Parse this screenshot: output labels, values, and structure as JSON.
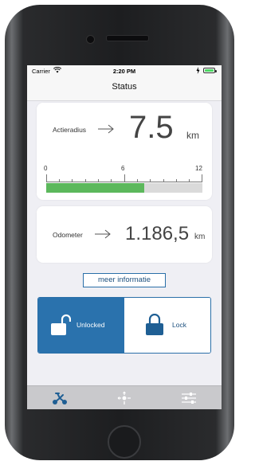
{
  "status_bar": {
    "carrier": "Carrier",
    "time": "2:20 PM"
  },
  "nav": {
    "title": "Status"
  },
  "range_card": {
    "label": "Actieradius",
    "value": "7.5",
    "unit": "km",
    "scale_ticks": [
      "0",
      "6",
      "12"
    ],
    "scale_min": 0,
    "scale_max": 12,
    "current": 7.5,
    "fill_color": "#5cb85c"
  },
  "odometer_card": {
    "label": "Odometer",
    "value": "1.186,5",
    "unit": "km"
  },
  "info_button": {
    "label": "meer informatie"
  },
  "lock_control": {
    "unlocked_label": "Unlocked",
    "lock_label": "Lock",
    "selected": "unlocked",
    "accent": "#2a72ad"
  },
  "tabs": [
    {
      "icon": "scooter-icon",
      "active": true
    },
    {
      "icon": "location-crosshair-icon",
      "active": false
    },
    {
      "icon": "sliders-icon",
      "active": false
    }
  ]
}
